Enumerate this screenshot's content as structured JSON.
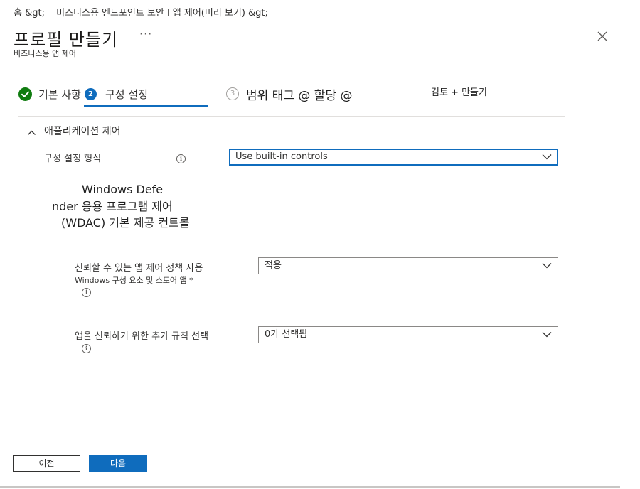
{
  "breadcrumb": {
    "home": "홈 &gt;",
    "path": "비즈니스용 엔드포인트 보안 l 앱 제어(미리 보기) &gt;"
  },
  "header": {
    "title": "프로필 만들기",
    "more": "···",
    "subtitle": "비즈니스용 앱 제어"
  },
  "wizard": {
    "steps": [
      {
        "number": "",
        "label": "기본 사항",
        "state": "completed"
      },
      {
        "number": "2",
        "label": "구성 설정",
        "state": "current"
      },
      {
        "number": "3",
        "label": "범위 태그 @ 할당 @",
        "state": "upcoming"
      },
      {
        "number": "",
        "label": "검토 + 만들기",
        "state": "upcoming"
      }
    ]
  },
  "section": {
    "title": "애플리케이션 제어"
  },
  "settings": {
    "format": {
      "label": "구성 설정 형식",
      "value": "Use built-in controls"
    },
    "wdac_lines": [
      "Windows Defe",
      "nder 응용 프로그램 제어",
      "(WDAC) 기본 제공 컨트롤"
    ],
    "trusted": {
      "label_line1": "신뢰할 수 있는 앱 제어 정책 사용",
      "label_line2": "Windows 구성 요소 및 스토어 앱 *",
      "value": "적용"
    },
    "additional": {
      "label": "앱을 신뢰하기 위한 추가 규칙 선택",
      "value": "0가 선택됨"
    }
  },
  "footer": {
    "prev_label": "이전",
    "next_label": "다음"
  },
  "colors": {
    "primary": "#0f6cbd",
    "success": "#107c10"
  }
}
